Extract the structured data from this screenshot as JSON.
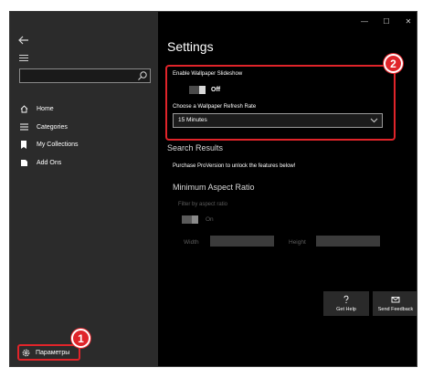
{
  "sidebar": {
    "items": [
      {
        "label": "Home",
        "icon": "home-icon"
      },
      {
        "label": "Categories",
        "icon": "list-icon"
      },
      {
        "label": "My Collections",
        "icon": "bookmark-icon"
      },
      {
        "label": "Add Ons",
        "icon": "add-ons-icon"
      }
    ],
    "settings_label": "Параметры"
  },
  "main": {
    "title": "Settings",
    "slideshow_label": "Enable Wallpaper Slideshow",
    "slideshow_state": "Off",
    "refresh_label": "Choose a Wallpaper Refresh Rate",
    "refresh_value": "15 Minutes",
    "search_results_heading": "Search Results",
    "pro_message": "Purchase ProVersion to unlock the features below!",
    "aspect_heading": "Minimum Aspect Ratio",
    "aspect_filter_label": "Filter by aspect ratio",
    "aspect_filter_state": "On",
    "width_label": "Width",
    "height_label": "Height",
    "get_help_label": "Get Help",
    "send_feedback_label": "Send Feedback"
  },
  "callouts": {
    "first": "1",
    "second": "2"
  },
  "colors": {
    "sidebar_bg": "#2b2b2b",
    "main_bg": "#000000",
    "highlight": "#e0242a"
  }
}
